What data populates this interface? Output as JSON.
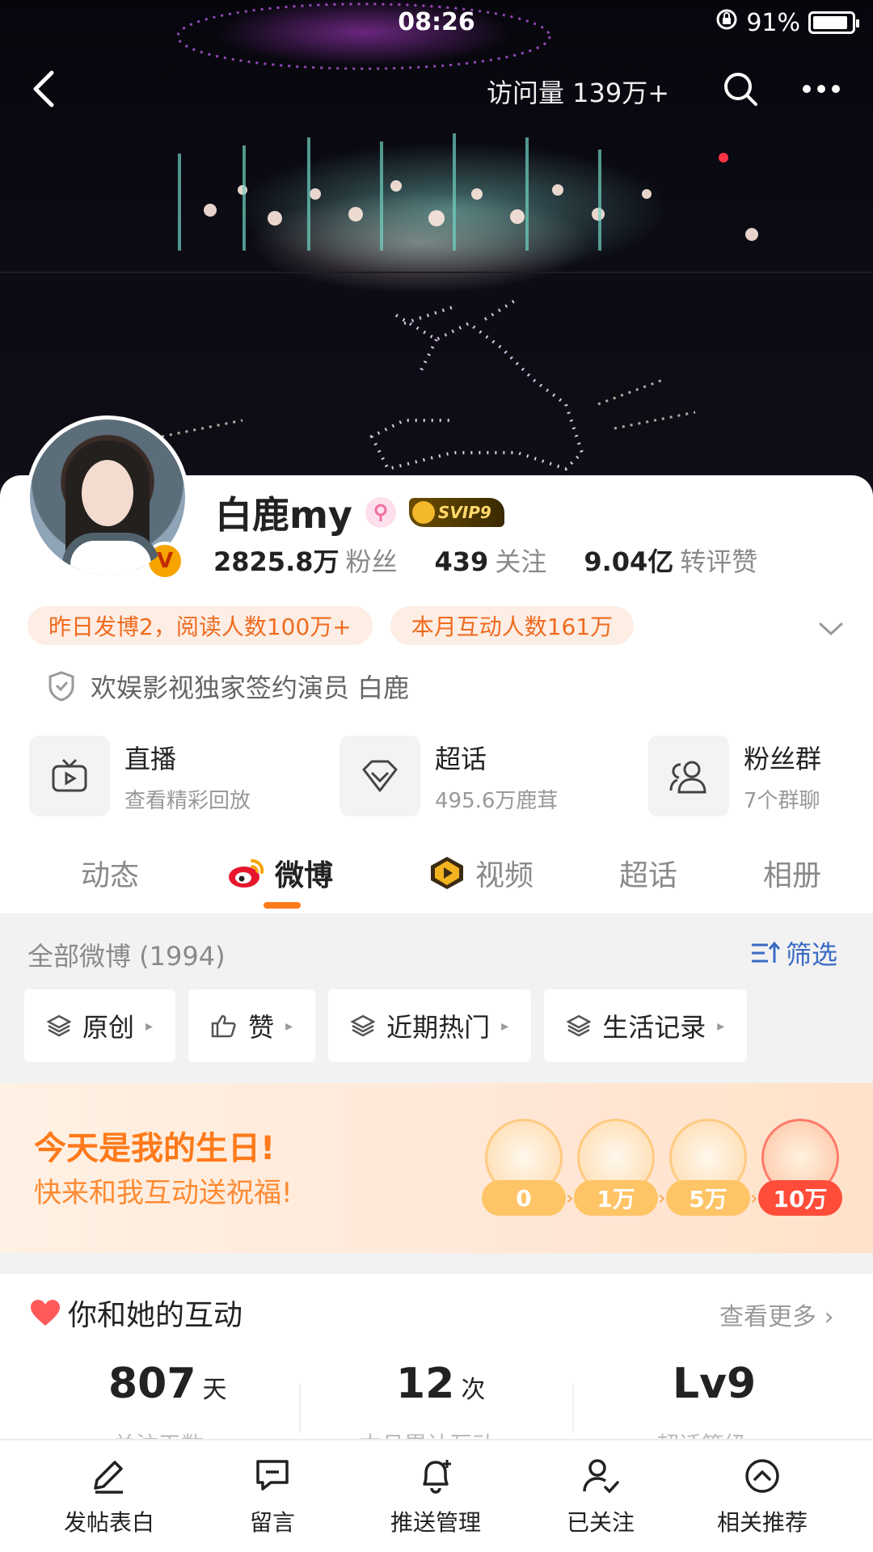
{
  "status_bar": {
    "time": "08:26",
    "battery": "91%"
  },
  "header": {
    "visits": "访问量 139万+"
  },
  "profile": {
    "name": "白鹿my",
    "svip": "SVIP9",
    "stats": {
      "fans_value": "2825.8万",
      "fans_label": "粉丝",
      "follow_value": "439",
      "follow_label": "关注",
      "likes_value": "9.04亿",
      "likes_label": "转评赞"
    },
    "tags": [
      "昨日发博2，阅读人数100万+",
      "本月互动人数161万"
    ],
    "verification": "欢娱影视独家签约演员 白鹿"
  },
  "services": [
    {
      "title": "直播",
      "sub": "查看精彩回放",
      "icon": "tv-icon"
    },
    {
      "title": "超话",
      "sub": "495.6万鹿茸",
      "icon": "diamond-icon"
    },
    {
      "title": "粉丝群",
      "sub": "7个群聊",
      "icon": "group-icon"
    }
  ],
  "tabs": [
    "动态",
    "微博",
    "视频",
    "超话",
    "相册"
  ],
  "weibo": {
    "all_label": "全部微博 (1994)",
    "filter_label": "筛选",
    "chips": [
      "原创",
      "赞",
      "近期热门",
      "生活记录"
    ]
  },
  "birthday": {
    "title": "今天是我的生日!",
    "subtitle": "快来和我互动送祝福!",
    "milestones": [
      "0",
      "1万",
      "5万",
      "10万"
    ]
  },
  "interaction": {
    "title": "你和她的互动",
    "more": "查看更多",
    "metrics": [
      {
        "value": "807",
        "unit": "天",
        "label": "关注天数"
      },
      {
        "value": "12",
        "unit": "次",
        "label": "本月累计互动"
      },
      {
        "value": "Lv9",
        "unit": "",
        "label": "超话等级"
      }
    ]
  },
  "bottom_bar": [
    "发帖表白",
    "留言",
    "推送管理",
    "已关注",
    "相关推荐"
  ],
  "colors": {
    "accent": "#ff7a1a",
    "link": "#3a6bc4",
    "tag_bg": "#fdeee5"
  }
}
